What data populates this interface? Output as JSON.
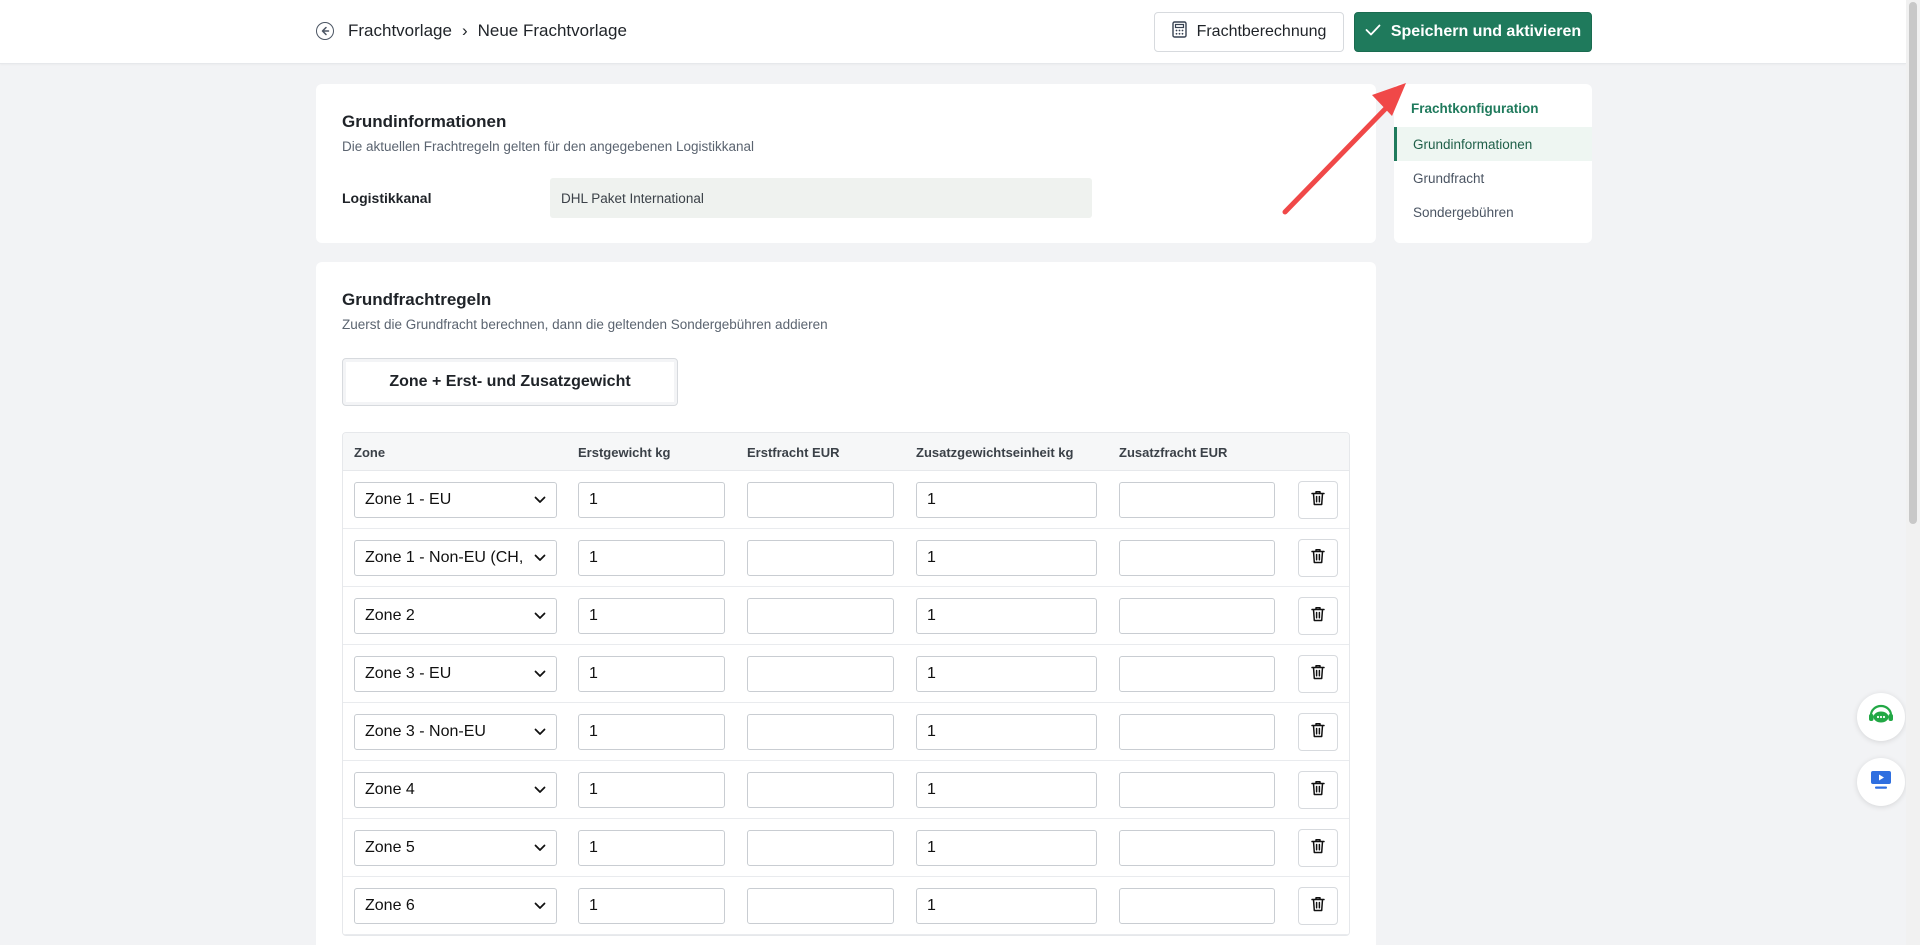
{
  "header": {
    "breadcrumb_parent": "Frachtvorlage",
    "breadcrumb_separator": "›",
    "breadcrumb_current": "Neue Frachtvorlage",
    "calc_button": "Frachtberechnung",
    "save_button": "Speichern und aktivieren"
  },
  "basic_info": {
    "title": "Grundinformationen",
    "subtitle": "Die aktuellen Frachtregeln gelten für den angegebenen Logistikkanal",
    "channel_label": "Logistikkanal",
    "channel_value": "DHL Paket International"
  },
  "rules": {
    "title": "Grundfrachtregeln",
    "subtitle": "Zuerst die Grundfracht berechnen, dann die geltenden Sondergebühren addieren",
    "mode_tab": "Zone + Erst- und Zusatzgewicht",
    "columns": {
      "zone": "Zone",
      "first_weight": "Erstgewicht kg",
      "first_freight": "Erstfracht EUR",
      "additional_unit": "Zusatzgewichtseinheit kg",
      "additional_freight": "Zusatzfracht EUR"
    },
    "rows": [
      {
        "zone": "Zone 1 - EU",
        "first_weight": "1",
        "first_freight": "",
        "additional_unit": "1",
        "additional_freight": ""
      },
      {
        "zone": "Zone 1 - Non-EU (CH,",
        "first_weight": "1",
        "first_freight": "",
        "additional_unit": "1",
        "additional_freight": ""
      },
      {
        "zone": "Zone 2",
        "first_weight": "1",
        "first_freight": "",
        "additional_unit": "1",
        "additional_freight": ""
      },
      {
        "zone": "Zone 3 - EU",
        "first_weight": "1",
        "first_freight": "",
        "additional_unit": "1",
        "additional_freight": ""
      },
      {
        "zone": "Zone 3 - Non-EU",
        "first_weight": "1",
        "first_freight": "",
        "additional_unit": "1",
        "additional_freight": ""
      },
      {
        "zone": "Zone 4",
        "first_weight": "1",
        "first_freight": "",
        "additional_unit": "1",
        "additional_freight": ""
      },
      {
        "zone": "Zone 5",
        "first_weight": "1",
        "first_freight": "",
        "additional_unit": "1",
        "additional_freight": ""
      },
      {
        "zone": "Zone 6",
        "first_weight": "1",
        "first_freight": "",
        "additional_unit": "1",
        "additional_freight": ""
      }
    ]
  },
  "sidenav": {
    "title": "Frachtkonfiguration",
    "items": [
      {
        "label": "Grundinformationen",
        "active": true
      },
      {
        "label": "Grundfracht",
        "active": false
      },
      {
        "label": "Sondergebühren",
        "active": false
      }
    ]
  },
  "icons": {
    "back": "arrow-left-circle-icon",
    "calc": "calculator-icon",
    "save": "check-icon",
    "select": "chevron-down-icon",
    "delete": "trash-icon",
    "support": "headset-chat-icon",
    "screen": "screen-share-icon"
  },
  "colors": {
    "accent": "#1f7a5c",
    "annotation_arrow": "#f04848",
    "support_icon": "#22a845",
    "screen_icon": "#2f6fe0"
  }
}
